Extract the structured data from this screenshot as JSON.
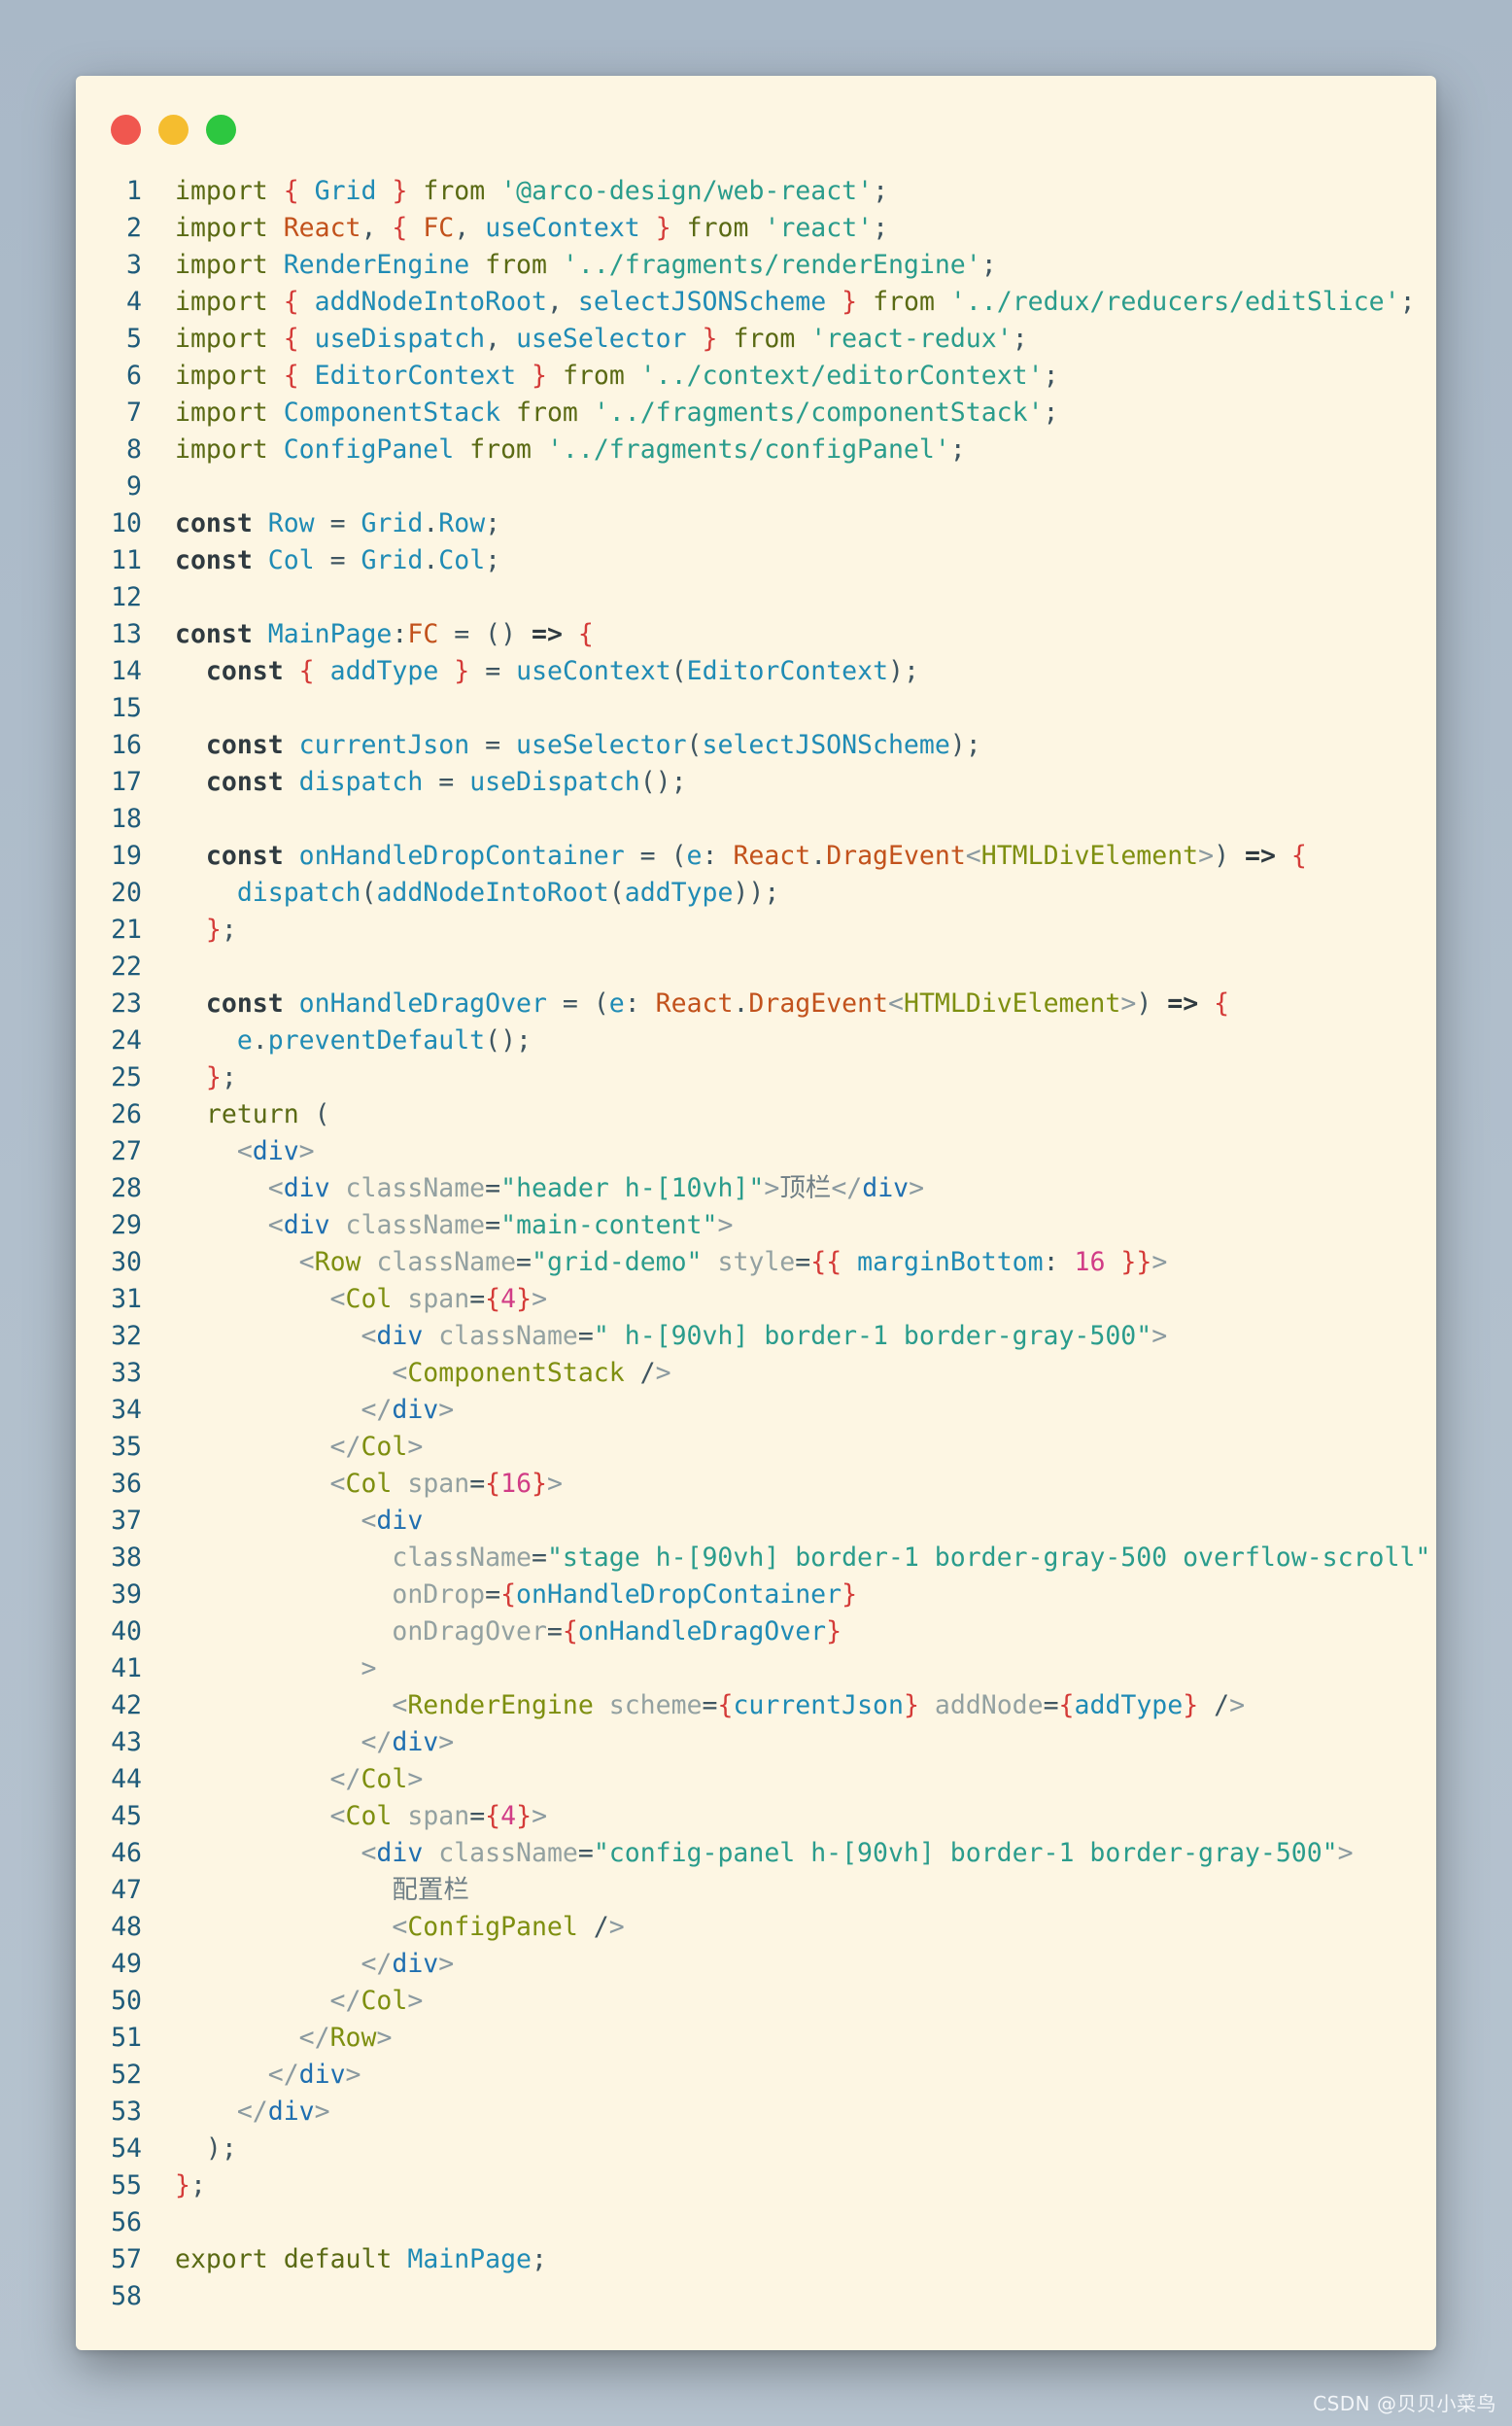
{
  "window": {
    "controls": [
      {
        "name": "close",
        "color": "#f0574f"
      },
      {
        "name": "minimize",
        "color": "#f5bd2f"
      },
      {
        "name": "maximize",
        "color": "#2dc740"
      }
    ]
  },
  "code": {
    "lines": [
      {
        "n": "1",
        "t": "import { Grid } from '@arco-design/web-react';"
      },
      {
        "n": "2",
        "t": "import React, { FC, useContext } from 'react';"
      },
      {
        "n": "3",
        "t": "import RenderEngine from '../fragments/renderEngine';"
      },
      {
        "n": "4",
        "t": "import { addNodeIntoRoot, selectJSONScheme } from '../redux/reducers/editSlice';"
      },
      {
        "n": "5",
        "t": "import { useDispatch, useSelector } from 'react-redux';"
      },
      {
        "n": "6",
        "t": "import { EditorContext } from '../context/editorContext';"
      },
      {
        "n": "7",
        "t": "import ComponentStack from '../fragments/componentStack';"
      },
      {
        "n": "8",
        "t": "import ConfigPanel from '../fragments/configPanel';"
      },
      {
        "n": "9",
        "t": ""
      },
      {
        "n": "10",
        "t": "const Row = Grid.Row;"
      },
      {
        "n": "11",
        "t": "const Col = Grid.Col;"
      },
      {
        "n": "12",
        "t": ""
      },
      {
        "n": "13",
        "t": "const MainPage:FC = () => {"
      },
      {
        "n": "14",
        "t": "  const { addType } = useContext(EditorContext);"
      },
      {
        "n": "15",
        "t": ""
      },
      {
        "n": "16",
        "t": "  const currentJson = useSelector(selectJSONScheme);"
      },
      {
        "n": "17",
        "t": "  const dispatch = useDispatch();"
      },
      {
        "n": "18",
        "t": ""
      },
      {
        "n": "19",
        "t": "  const onHandleDropContainer = (e: React.DragEvent<HTMLDivElement>) => {"
      },
      {
        "n": "20",
        "t": "    dispatch(addNodeIntoRoot(addType));"
      },
      {
        "n": "21",
        "t": "  };"
      },
      {
        "n": "22",
        "t": ""
      },
      {
        "n": "23",
        "t": "  const onHandleDragOver = (e: React.DragEvent<HTMLDivElement>) => {"
      },
      {
        "n": "24",
        "t": "    e.preventDefault();"
      },
      {
        "n": "25",
        "t": "  };"
      },
      {
        "n": "26",
        "t": "  return ("
      },
      {
        "n": "27",
        "t": "    <div>"
      },
      {
        "n": "28",
        "t": "      <div className=\"header h-[10vh]\">顶栏</div>"
      },
      {
        "n": "29",
        "t": "      <div className=\"main-content\">"
      },
      {
        "n": "30",
        "t": "        <Row className=\"grid-demo\" style={{ marginBottom: 16 }}>"
      },
      {
        "n": "31",
        "t": "          <Col span={4}>"
      },
      {
        "n": "32",
        "t": "            <div className=\" h-[90vh] border-1 border-gray-500\">"
      },
      {
        "n": "33",
        "t": "              <ComponentStack />"
      },
      {
        "n": "34",
        "t": "            </div>"
      },
      {
        "n": "35",
        "t": "          </Col>"
      },
      {
        "n": "36",
        "t": "          <Col span={16}>"
      },
      {
        "n": "37",
        "t": "            <div"
      },
      {
        "n": "38",
        "t": "              className=\"stage h-[90vh] border-1 border-gray-500 overflow-scroll\""
      },
      {
        "n": "39",
        "t": "              onDrop={onHandleDropContainer}"
      },
      {
        "n": "40",
        "t": "              onDragOver={onHandleDragOver}"
      },
      {
        "n": "41",
        "t": "            >"
      },
      {
        "n": "42",
        "t": "              <RenderEngine scheme={currentJson} addNode={addType} />"
      },
      {
        "n": "43",
        "t": "            </div>"
      },
      {
        "n": "44",
        "t": "          </Col>"
      },
      {
        "n": "45",
        "t": "          <Col span={4}>"
      },
      {
        "n": "46",
        "t": "            <div className=\"config-panel h-[90vh] border-1 border-gray-500\">"
      },
      {
        "n": "47",
        "t": "              配置栏"
      },
      {
        "n": "48",
        "t": "              <ConfigPanel />"
      },
      {
        "n": "49",
        "t": "            </div>"
      },
      {
        "n": "50",
        "t": "          </Col>"
      },
      {
        "n": "51",
        "t": "        </Row>"
      },
      {
        "n": "52",
        "t": "      </div>"
      },
      {
        "n": "53",
        "t": "    </div>"
      },
      {
        "n": "54",
        "t": "  );"
      },
      {
        "n": "55",
        "t": "};"
      },
      {
        "n": "56",
        "t": ""
      },
      {
        "n": "57",
        "t": "export default MainPage;"
      },
      {
        "n": "58",
        "t": ""
      }
    ]
  },
  "watermark": "CSDN @贝贝小菜鸟"
}
